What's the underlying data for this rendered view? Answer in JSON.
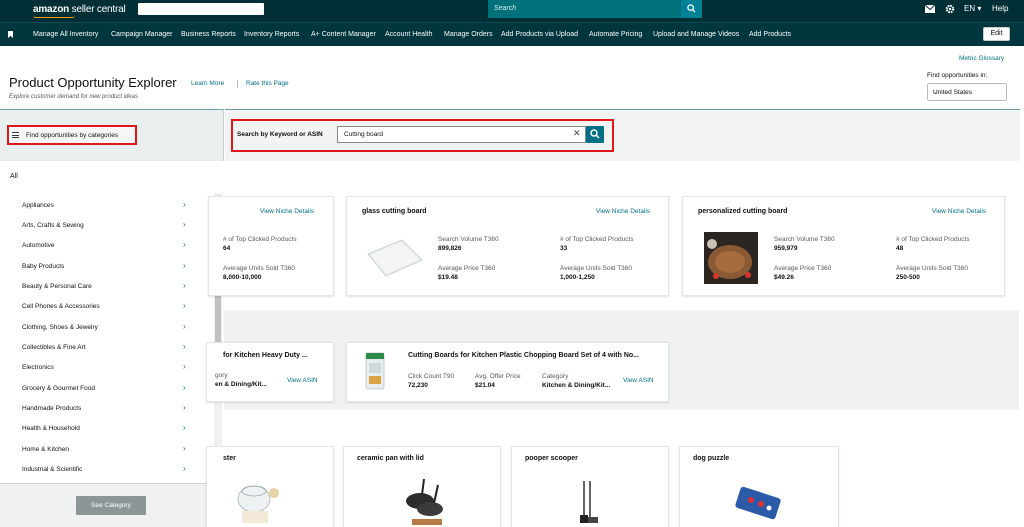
{
  "header": {
    "logo_main": "amazon",
    "logo_sub": " seller central",
    "search_placeholder": "Search",
    "language": "EN",
    "help": "Help"
  },
  "nav": {
    "items": [
      "Manage All Inventory",
      "Campaign Manager",
      "Business Reports",
      "Inventory Reports",
      "A+ Content Manager",
      "Account Health",
      "Manage Orders",
      "Add Products via Upload",
      "Automate Pricing",
      "Upload and Manage Videos",
      "Add Products"
    ],
    "edit": "Edit"
  },
  "page": {
    "title": "Product Opportunity Explorer",
    "learn_more": "Learn More",
    "rate": "Rate this Page",
    "subtitle": "Explore customer demand for new product ideas",
    "metric_glossary": "Metric Glossary",
    "find_in_label": "Find opportunities in:",
    "country": "United States"
  },
  "left": {
    "toggle_label": "Find opportunities by categories",
    "all": "All",
    "categories": [
      "Appliances",
      "Arts, Crafts & Sewing",
      "Automotive",
      "Baby Products",
      "Beauty & Personal Care",
      "Cell Phones & Accessories",
      "Clothing, Shoes & Jewelry",
      "Collectibles & Fine Art",
      "Electronics",
      "Grocery & Gourmet Food",
      "Handmade Products",
      "Health & Household",
      "Home & Kitchen",
      "Industrial & Scientific"
    ],
    "see_category": "See Category"
  },
  "search": {
    "label": "Search by Keyword or ASIN",
    "value": "Cutting board"
  },
  "niches": [
    {
      "title": "",
      "link": "View Niche Details",
      "sv_label": "",
      "sv": "",
      "top_label": "# of Top Clicked Products",
      "top": "64",
      "price_label": "",
      "price": "",
      "units_label": "Average Units Sold T360",
      "units": "8,000-10,000"
    },
    {
      "title": "glass cutting board",
      "link": "View Niche Details",
      "sv_label": "Search Volume T360",
      "sv": "899,826",
      "top_label": "# of Top Clicked Products",
      "top": "33",
      "price_label": "Average Price T360",
      "price": "$19.48",
      "units_label": "Average Units Sold T360",
      "units": "1,000-1,250"
    },
    {
      "title": "personalized cutting board",
      "link": "View Niche Details",
      "sv_label": "Search Volume T360",
      "sv": "959,979",
      "top_label": "# of Top Clicked Products",
      "top": "48",
      "price_label": "Average Price T360",
      "price": "$49.26",
      "units_label": "Average Units Sold T360",
      "units": "250-500"
    }
  ],
  "products": [
    {
      "title": "for Kitchen Heavy Duty ...",
      "cat_label": "gory",
      "cat": "en & Dining/Kit...",
      "link": "View ASIN"
    },
    {
      "title": "Cutting Boards for Kitchen Plastic Chopping Board Set of 4 with No...",
      "click_label": "Click Count T90",
      "click": "72,230",
      "offer_label": "Avg. Offer Price",
      "offer": "$21.04",
      "cat_label": "Category",
      "cat": "Kitchen & Dining/Kit...",
      "link": "View ASIN"
    }
  ],
  "related": [
    "ster",
    "ceramic pan with lid",
    "pooper scooper",
    "dog puzzle"
  ],
  "icons": {
    "mail": "mail-icon",
    "gear": "gear-icon",
    "search": "search-icon",
    "menu": "menu-icon",
    "bookmark": "bookmark-icon"
  },
  "colors": {
    "topbar": "#002f36",
    "nav": "#00363e",
    "link": "#007185",
    "highlight": "#e0161b"
  }
}
